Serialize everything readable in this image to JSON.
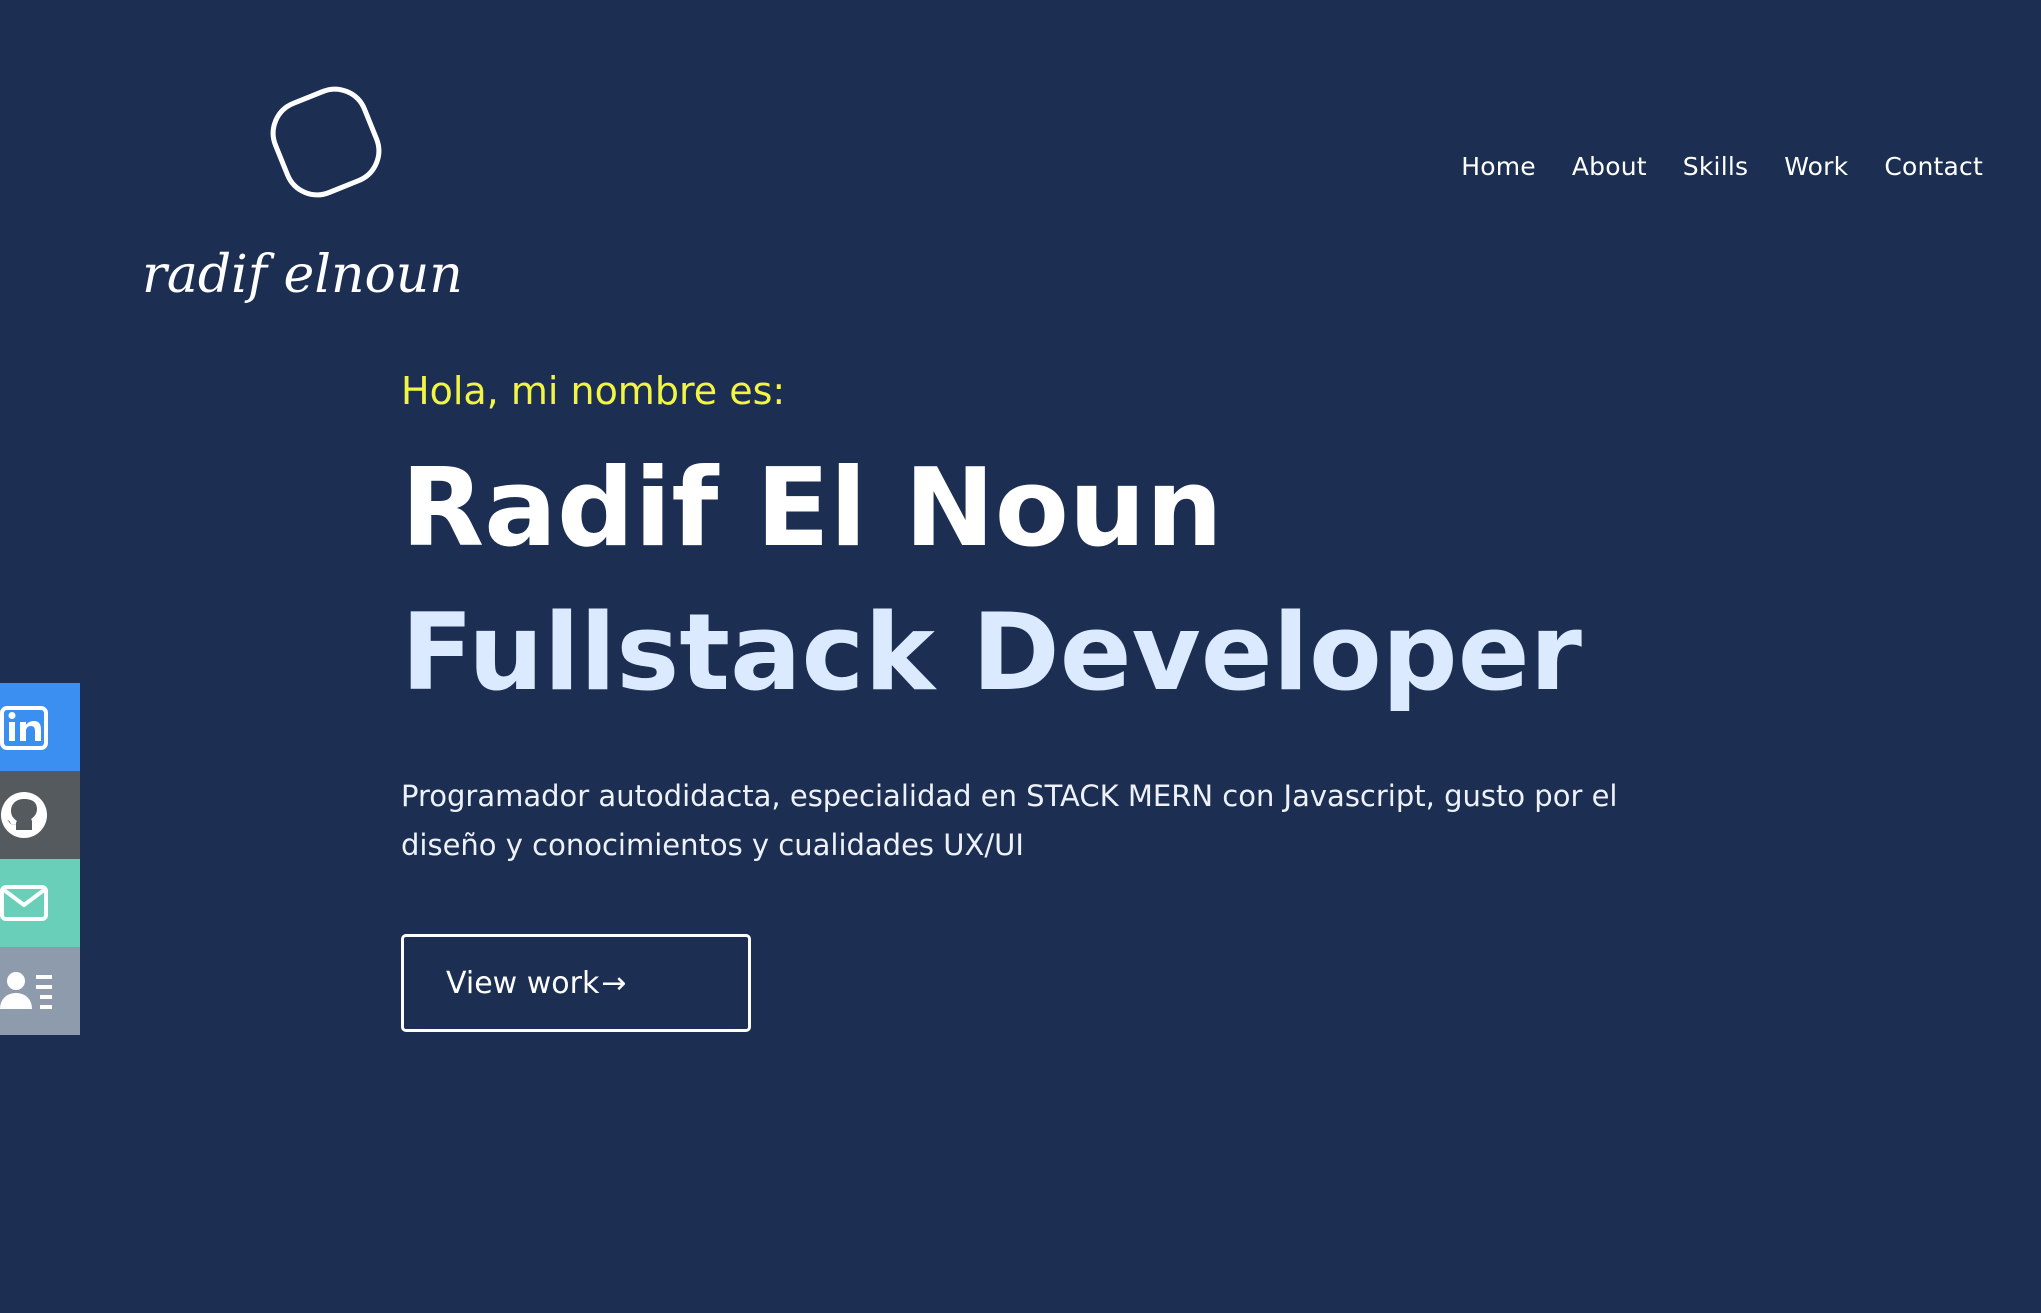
{
  "logo": {
    "text": "radif elnoun",
    "icon": "rounded-blob-logo-icon"
  },
  "nav": {
    "items": [
      {
        "label": "Home"
      },
      {
        "label": "About"
      },
      {
        "label": "Skills"
      },
      {
        "label": "Work"
      },
      {
        "label": "Contact"
      }
    ]
  },
  "hero": {
    "greeting": "Hola, mi nombre es:",
    "name": "Radif El Noun",
    "role": "Fullstack Developer",
    "description": "Programador autodidacta, especialidad en STACK MERN con Javascript, gusto por el diseño y conocimientos y cualidades UX/UI",
    "cta_label": "View work",
    "cta_arrow": "→"
  },
  "social": [
    {
      "icon": "linkedin-icon",
      "color": "#3b8ff0"
    },
    {
      "icon": "github-icon",
      "color": "#555a5e"
    },
    {
      "icon": "mail-icon",
      "color": "#6acfb8"
    },
    {
      "icon": "resume-icon",
      "color": "#8d9bac"
    }
  ],
  "colors": {
    "background": "#1c2f53",
    "accent": "#f2f542",
    "role": "#dceaff"
  }
}
